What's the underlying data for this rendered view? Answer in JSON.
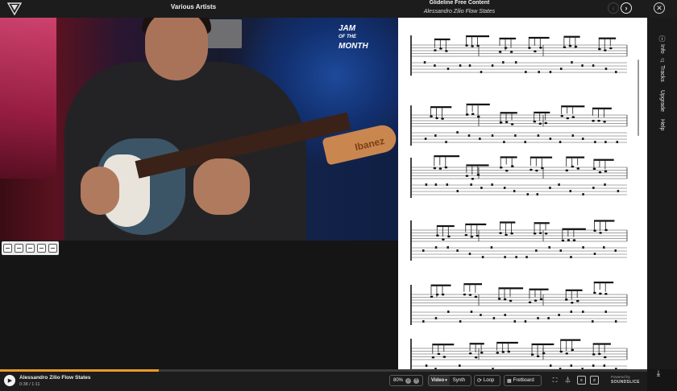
{
  "header": {
    "artist": "Various Artists",
    "series": "Glideline Free Content",
    "piece": "Alessandro Zilio Flow States",
    "prev_icon": "chevron-left-icon",
    "next_icon": "chevron-right-icon",
    "close_icon": "close-icon"
  },
  "video": {
    "overlay_logo_lines": [
      "JAM",
      "OF THE",
      "MONTH"
    ],
    "guitar_brand": "Ibanez",
    "tools": [
      "layout-icon",
      "swap-icon",
      "fullscreen-icon",
      "minimize-icon",
      "notes-icon"
    ]
  },
  "sidebar": {
    "items": [
      {
        "label": "Info",
        "icon": "info-icon"
      },
      {
        "label": "Tracks",
        "icon": "music-note-icon"
      },
      {
        "label": "Upgrade",
        "icon": ""
      },
      {
        "label": "Help",
        "icon": ""
      }
    ],
    "download_icon": "download-icon"
  },
  "player": {
    "title": "Alessandro Zilio Flow States",
    "time": "0:38 / 1:11",
    "progress": 0.245,
    "zoom": "80%",
    "zoom_out": "−",
    "zoom_in": "+",
    "media_selected": "Video",
    "media_other": "Synth",
    "loop_label": "Loop",
    "fretboard_label": "Fretboard",
    "powered_by": "Powered by",
    "powered_brand": "SOUNDSLICE"
  },
  "colors": {
    "accent": "#e89a2a",
    "background": "#151515",
    "bar": "#1c1c1c",
    "sheet": "#ffffff"
  }
}
